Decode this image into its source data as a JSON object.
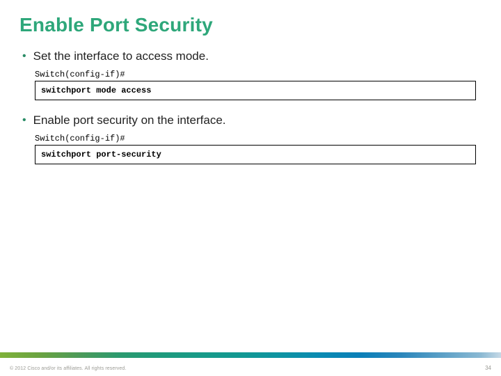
{
  "title": "Enable Port Security",
  "steps": [
    {
      "bullet": "Set the interface to access mode.",
      "prompt": "Switch(config-if)#",
      "command": "switchport mode access"
    },
    {
      "bullet": "Enable port security on the interface.",
      "prompt": "Switch(config-if)#",
      "command": "switchport port-security"
    }
  ],
  "footer": {
    "copyright": "© 2012 Cisco and/or its affiliates. All rights reserved.",
    "page_number": "34"
  }
}
